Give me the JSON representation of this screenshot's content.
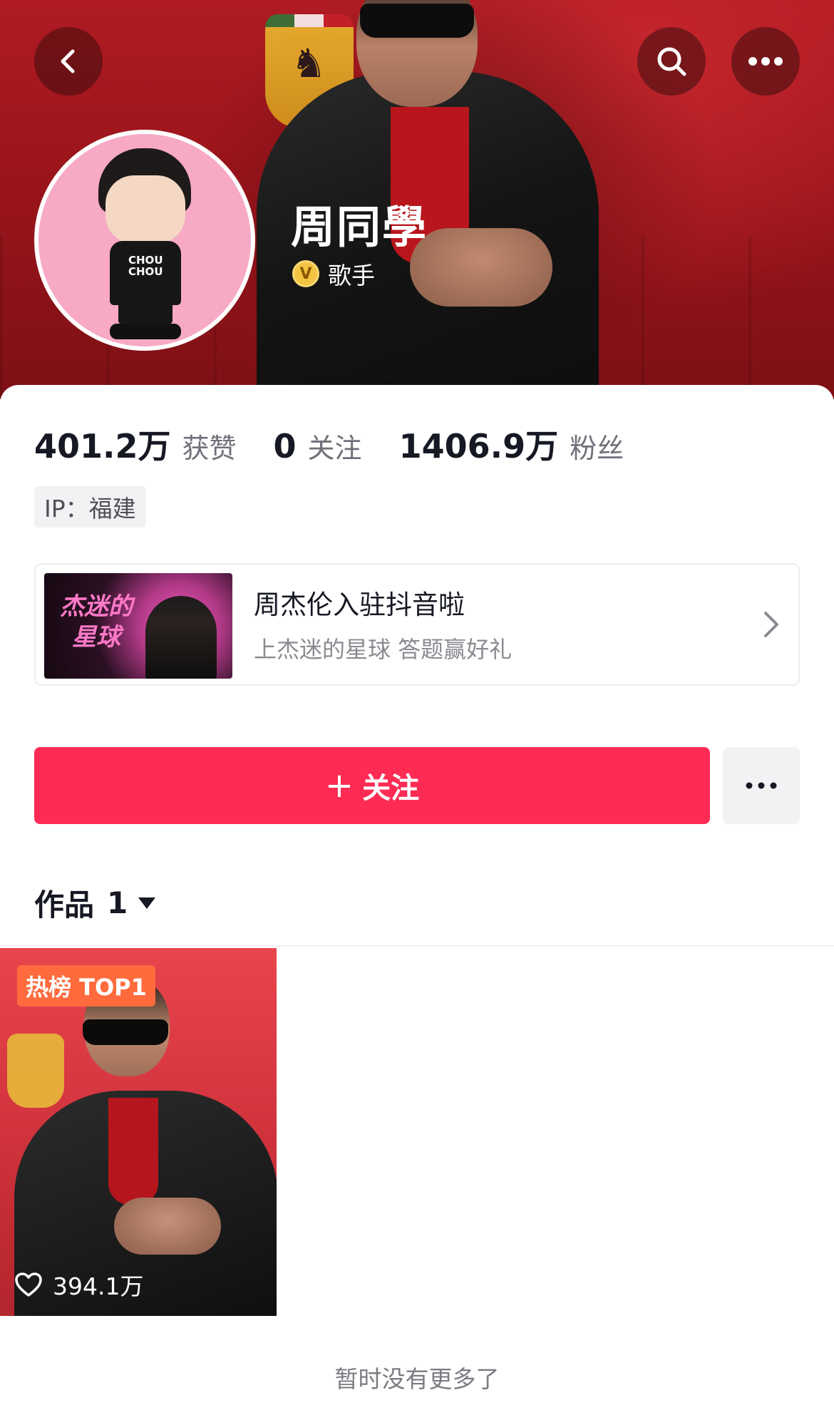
{
  "header": {
    "back_icon": "back-arrow-icon",
    "search_icon": "search-icon",
    "more_icon": "more-dots-icon"
  },
  "profile": {
    "name": "周同學",
    "verify_badge": "V",
    "verify_label": "歌手",
    "avatar_shirt_text": "CHOU CHOU"
  },
  "stats": [
    {
      "value": "401.2万",
      "label": "获赞"
    },
    {
      "value": "0",
      "label": "关注"
    },
    {
      "value": "1406.9万",
      "label": "粉丝"
    }
  ],
  "ip_tag": "IP：福建",
  "promo": {
    "thumb_text": "杰迷的星球",
    "title": "周杰伦入驻抖音啦",
    "subtitle": "上杰迷的星球 答题赢好礼"
  },
  "actions": {
    "follow_plus": "+",
    "follow_label": "关注"
  },
  "works": {
    "label": "作品",
    "count": "1"
  },
  "videos": [
    {
      "badge": "热榜 TOP1",
      "likes": "394.1万"
    }
  ],
  "footer": {
    "end_text": "暂时没有更多了"
  },
  "colors": {
    "accent": "#fe2c55",
    "hero_red": "#a8181f",
    "hot_badge": "#ff6b3d",
    "verify_gold": "#f3c443"
  }
}
